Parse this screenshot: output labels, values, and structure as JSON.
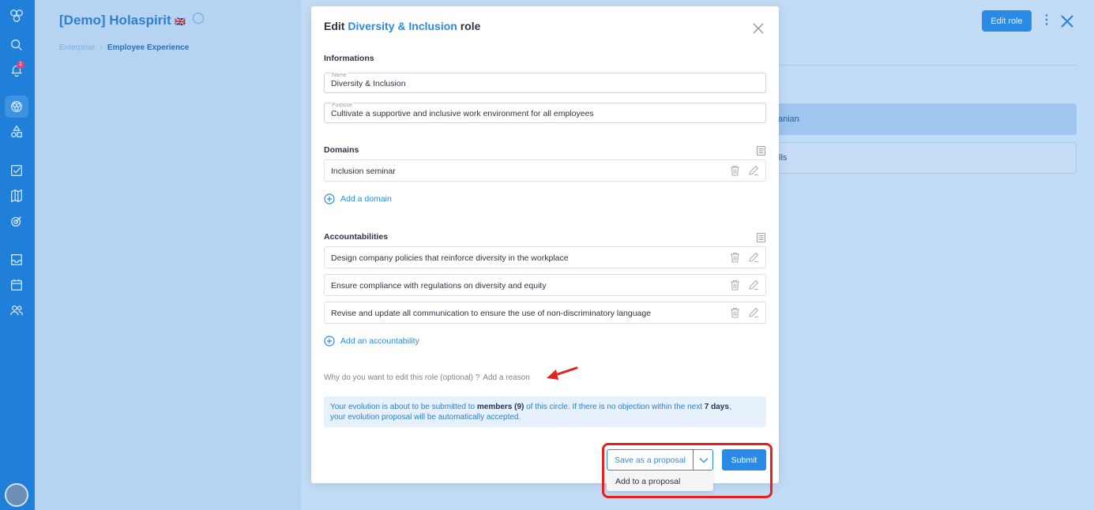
{
  "background": {
    "workspace_title": "[Demo] Holaspirit",
    "flag": "🇬🇧",
    "breadcrumb": [
      "Enterprise",
      "Employee Experience"
    ],
    "edit_role_button": "Edit role",
    "kebab": "⋮",
    "list_items": [
      "anian",
      "lls"
    ],
    "notification_count": "1"
  },
  "modal": {
    "title_prefix": "Edit",
    "title_role": "Diversity & Inclusion",
    "title_suffix": "role",
    "informations": {
      "heading": "Informations",
      "name_label": "Name",
      "name_value": "Diversity & Inclusion",
      "purpose_label": "Purpose",
      "purpose_value": "Cultivate a supportive and inclusive work environment for all employees"
    },
    "domains": {
      "heading": "Domains",
      "items": [
        "Inclusion seminar"
      ],
      "add_label": "Add a domain"
    },
    "accountabilities": {
      "heading": "Accountabilities",
      "items": [
        "Design company policies that reinforce diversity in the workplace",
        "Ensure compliance with regulations on diversity and equity",
        "Revise and update all communication to ensure the use of non-discriminatory language"
      ],
      "add_label": "Add an accountability"
    },
    "reason": {
      "question": "Why do you want to edit this role (optional) ?",
      "link": "Add a reason"
    },
    "info": {
      "part1": "Your evolution is about to be submitted to ",
      "members": "members (9)",
      "part2": " of this circle. If there is no objection within the next ",
      "days": "7 days",
      "part3": ",",
      "line2": "your evolution proposal will be automatically accepted."
    },
    "save_proposal_button": "Save as a proposal",
    "submit_button": "Submit",
    "dropdown_option": "Add to a proposal"
  },
  "colors": {
    "accent": "#2a8ae6",
    "nav_rail": "#1f7fd9",
    "annotation": "#e8211d"
  }
}
